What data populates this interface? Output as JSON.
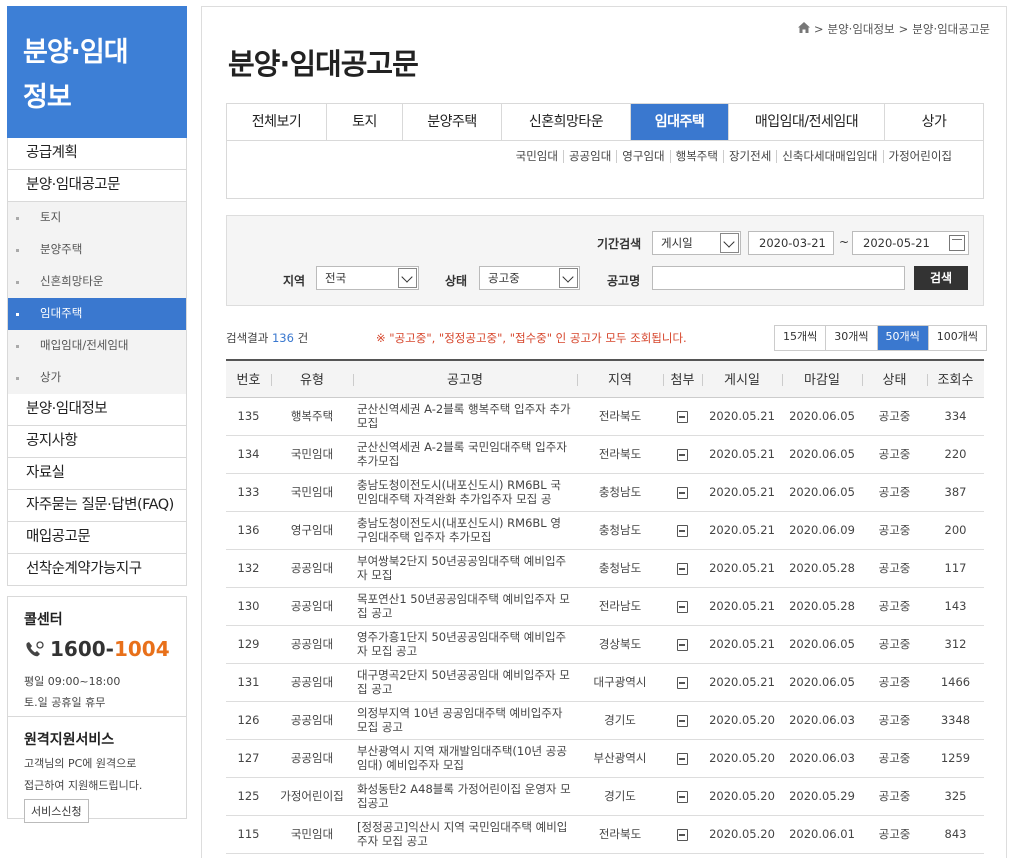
{
  "sidebar": {
    "title_line1": "분양·임대",
    "title_line2": "정보",
    "menu": [
      {
        "label": "공급계획"
      },
      {
        "label": "분양·임대공고문"
      }
    ],
    "sub": [
      {
        "label": "토지"
      },
      {
        "label": "분양주택"
      },
      {
        "label": "신혼희망타운"
      },
      {
        "label": "임대주택",
        "active": true
      },
      {
        "label": "매입임대/전세임대"
      },
      {
        "label": "상가"
      }
    ],
    "menu2": [
      {
        "label": "분양·임대정보"
      },
      {
        "label": "공지사항"
      },
      {
        "label": "자료실"
      },
      {
        "label": "자주묻는 질문·답변(FAQ)"
      },
      {
        "label": "매입공고문"
      },
      {
        "label": "선착순계약가능지구"
      }
    ],
    "call_center": {
      "title": "콜센터",
      "number_prefix": "1600-",
      "number_suffix": "1004",
      "hours1": "평일 09:00~18:00",
      "hours2": "토.일 공휴일 휴무"
    },
    "remote": {
      "title": "원격지원서비스",
      "desc1": "고객님의 PC에 원격으로",
      "desc2": "접근하여 지원해드립니다.",
      "button": "서비스신청"
    }
  },
  "breadcrumb": {
    "item1": "분양·임대정보",
    "item2": "분양·임대공고문"
  },
  "page_title": "분양·임대공고문",
  "tabs": [
    {
      "label": "전체보기",
      "w": 100
    },
    {
      "label": "토지",
      "w": 76
    },
    {
      "label": "분양주택",
      "w": 99
    },
    {
      "label": "신혼희망타운",
      "w": 129
    },
    {
      "label": "임대주택",
      "w": 98,
      "active": true
    },
    {
      "label": "매입임대/전세임대",
      "w": 156
    },
    {
      "label": "상가",
      "w": 98
    }
  ],
  "subtabs": [
    "국민임대",
    "공공임대",
    "영구임대",
    "행복주택",
    "장기전세",
    "신축다세대매입임대",
    "가정어린이집"
  ],
  "search": {
    "period_label": "기간검색",
    "period_type": "게시일",
    "date_from": "2020-03-21",
    "tilde": "~",
    "date_to": "2020-05-21",
    "region_label": "지역",
    "region_value": "전국",
    "status_label": "상태",
    "status_value": "공고중",
    "name_label": "공고명",
    "name_value": "",
    "button": "검색"
  },
  "results": {
    "prefix": "검색결과",
    "count": "136",
    "suffix": "건",
    "notice": "※ \"공고중\", \"정정공고중\", \"접수중\" 인 공고가 모두 조회됩니다."
  },
  "per_page": [
    {
      "label": "15개씩"
    },
    {
      "label": "30개씩"
    },
    {
      "label": "50개씩",
      "active": true
    },
    {
      "label": "100개씩"
    }
  ],
  "table": {
    "headers": [
      "번호",
      "유형",
      "공고명",
      "지역",
      "첨부",
      "게시일",
      "마감일",
      "상태",
      "조회수"
    ],
    "rows": [
      {
        "no": "135",
        "type": "행복주택",
        "title": "군산신역세권 A-2블록 행복주택 입주자 추가모집",
        "region": "전라북도",
        "posted": "2020.05.21",
        "deadline": "2020.06.05",
        "status": "공고중",
        "views": "334"
      },
      {
        "no": "134",
        "type": "국민임대",
        "title": "군산신역세권 A-2블록 국민임대주택 입주자 추가모집",
        "region": "전라북도",
        "posted": "2020.05.21",
        "deadline": "2020.06.05",
        "status": "공고중",
        "views": "220"
      },
      {
        "no": "133",
        "type": "국민임대",
        "title": "충남도청이전도시(내포신도시) RM6BL 국민임대주택 자격완화 추가입주자 모집 공",
        "region": "충청남도",
        "posted": "2020.05.21",
        "deadline": "2020.06.05",
        "status": "공고중",
        "views": "387"
      },
      {
        "no": "136",
        "type": "영구임대",
        "title": "충남도청이전도시(내포신도시) RM6BL 영구임대주택 입주자 추가모집",
        "region": "충청남도",
        "posted": "2020.05.21",
        "deadline": "2020.06.09",
        "status": "공고중",
        "views": "200"
      },
      {
        "no": "132",
        "type": "공공임대",
        "title": "부여쌍북2단지 50년공공임대주택 예비입주자 모집",
        "region": "충청남도",
        "posted": "2020.05.21",
        "deadline": "2020.05.28",
        "status": "공고중",
        "views": "117"
      },
      {
        "no": "130",
        "type": "공공임대",
        "title": "목포연산1 50년공공임대주택 예비입주자 모집 공고",
        "region": "전라남도",
        "posted": "2020.05.21",
        "deadline": "2020.05.28",
        "status": "공고중",
        "views": "143"
      },
      {
        "no": "129",
        "type": "공공임대",
        "title": "영주가흥1단지 50년공공임대주택 예비입주자 모집 공고",
        "region": "경상북도",
        "posted": "2020.05.21",
        "deadline": "2020.06.05",
        "status": "공고중",
        "views": "312"
      },
      {
        "no": "131",
        "type": "공공임대",
        "title": "대구명곡2단지 50년공공임대 예비입주자 모집 공고",
        "region": "대구광역시",
        "posted": "2020.05.21",
        "deadline": "2020.06.05",
        "status": "공고중",
        "views": "1466"
      },
      {
        "no": "126",
        "type": "공공임대",
        "title": "의정부지역 10년 공공임대주택 예비입주자모집 공고",
        "region": "경기도",
        "posted": "2020.05.20",
        "deadline": "2020.06.03",
        "status": "공고중",
        "views": "3348"
      },
      {
        "no": "127",
        "type": "공공임대",
        "title": "부산광역시 지역 재개발임대주택(10년 공공임대) 예비입주자 모집",
        "region": "부산광역시",
        "posted": "2020.05.20",
        "deadline": "2020.06.03",
        "status": "공고중",
        "views": "1259"
      },
      {
        "no": "125",
        "type": "가정어린이집",
        "title": "화성동탄2 A48블록 가정어린이집 운영자 모집공고",
        "region": "경기도",
        "posted": "2020.05.20",
        "deadline": "2020.05.29",
        "status": "공고중",
        "views": "325"
      },
      {
        "no": "115",
        "type": "국민임대",
        "title": "[정정공고]익산시 지역 국민임대주택 예비입주자 모집 공고",
        "region": "전라북도",
        "posted": "2020.05.20",
        "deadline": "2020.06.01",
        "status": "공고중",
        "views": "843"
      }
    ]
  }
}
